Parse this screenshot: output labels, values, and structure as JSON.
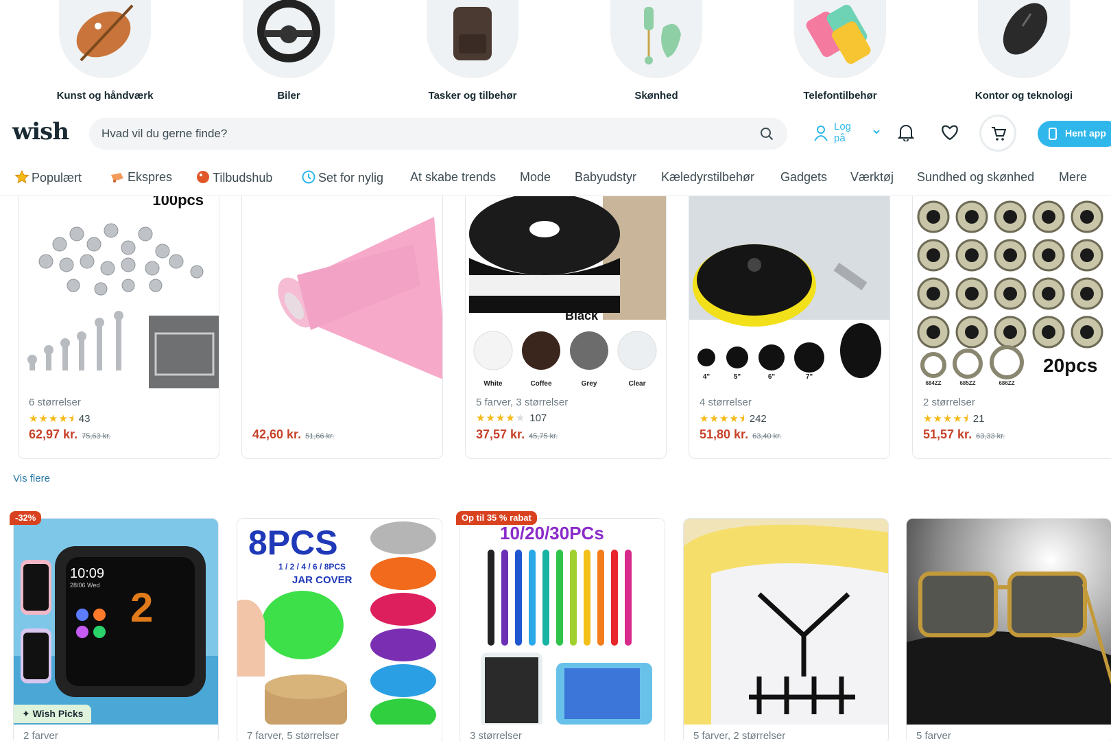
{
  "categories": [
    {
      "label": "Kunst og håndværk",
      "icon": "palette-icon"
    },
    {
      "label": "Biler",
      "icon": "steering-wheel-icon"
    },
    {
      "label": "Tasker og tilbehør",
      "icon": "backpack-icon"
    },
    {
      "label": "Skønhed",
      "icon": "jade-roller-icon"
    },
    {
      "label": "Telefontilbehør",
      "icon": "phone-cases-icon"
    },
    {
      "label": "Kontor og teknologi",
      "icon": "mouse-icon"
    }
  ],
  "header": {
    "logo": "wish",
    "search_placeholder": "Hvad vil du gerne finde?",
    "login_label": "Log på",
    "get_app_label": "Hent app",
    "accent_color": "#2fb7ec"
  },
  "nav": {
    "items": [
      {
        "label": "Populært",
        "icon": "star-icon"
      },
      {
        "label": "Ekspres",
        "icon": "truck-icon"
      },
      {
        "label": "Tilbudshub",
        "icon": "tag-icon"
      },
      {
        "label": "Set for nylig",
        "icon": "clock-icon"
      },
      {
        "label": "At skabe trends"
      },
      {
        "label": "Mode"
      },
      {
        "label": "Babyudstyr"
      },
      {
        "label": "Kæledyrstilbehør"
      },
      {
        "label": "Gadgets"
      },
      {
        "label": "Værktøj"
      },
      {
        "label": "Sundhed og skønhed"
      },
      {
        "label": "Mere"
      }
    ]
  },
  "products_row1": [
    {
      "image_text": "100pcs",
      "meta": "6 størrelser",
      "rating": 4.5,
      "reviews": "43",
      "price": "62,97 kr.",
      "old_price": "75,63 kr."
    },
    {
      "meta": "",
      "price": "42,60 kr.",
      "old_price": "51,66 kr."
    },
    {
      "image_text": "Black",
      "swatches": [
        "White",
        "Coffee",
        "Grey",
        "Clear"
      ],
      "meta": "5 farver, 3 størrelser",
      "rating": 4,
      "reviews": "107",
      "price": "37,57 kr.",
      "old_price": "45,75 kr."
    },
    {
      "sizes": [
        "4\"",
        "5\"",
        "6\"",
        "7\""
      ],
      "meta": "4 størrelser",
      "rating": 4.5,
      "reviews": "242",
      "price": "51,80 kr.",
      "old_price": "63,40 kr."
    },
    {
      "image_text": "20pcs",
      "bearing_labels": [
        "684ZZ",
        "685ZZ",
        "686ZZ"
      ],
      "meta": "2 størrelser",
      "rating": 4.5,
      "reviews": "21",
      "price": "51,57 kr.",
      "old_price": "63,33 kr."
    }
  ],
  "see_more": "Vis flere",
  "products_row2": [
    {
      "badge": "-32%",
      "label": "Wish Picks",
      "watch_time": "10:09",
      "watch_date": "28/06 Wed",
      "meta": "2 farver"
    },
    {
      "image_title": "8PCS",
      "image_sub": "1 / 2 / 4 / 6 / 8PCS",
      "image_sub2": "JAR COVER",
      "meta": "7 farver, 5 størrelser"
    },
    {
      "badge": "Op til 35 % rabat",
      "image_title": "10/20/30PCs",
      "meta": "3 størrelser"
    },
    {
      "meta": "5 farver, 2 størrelser"
    },
    {
      "meta": "5 farver"
    }
  ]
}
